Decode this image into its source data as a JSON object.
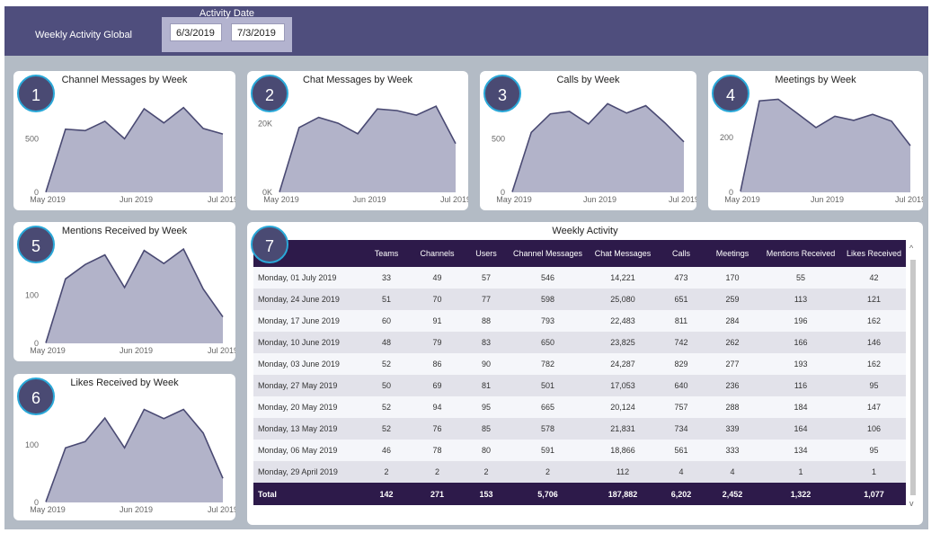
{
  "header": {
    "title": "Weekly Activity Global",
    "date_label": "Activity Date",
    "date_start": "6/3/2019",
    "date_end": "7/3/2019"
  },
  "colors": {
    "header_bg": "#4f4e7d",
    "area_fill": "#b2b3c9",
    "line": "#4a4a73",
    "table_header": "#2d1a4a",
    "badge_border": "#2aa8d8"
  },
  "charts": [
    {
      "badge": "1",
      "title": "Channel Messages by Week",
      "yticks": [
        "0",
        "500"
      ],
      "xticks": [
        "May 2019",
        "Jun 2019",
        "Jul 2019"
      ]
    },
    {
      "badge": "2",
      "title": "Chat Messages by Week",
      "yticks": [
        "0K",
        "20K"
      ],
      "xticks": [
        "May 2019",
        "Jun 2019",
        "Jul 2019"
      ]
    },
    {
      "badge": "3",
      "title": "Calls by Week",
      "yticks": [
        "0",
        "500"
      ],
      "xticks": [
        "May 2019",
        "Jun 2019",
        "Jul 2019"
      ]
    },
    {
      "badge": "4",
      "title": "Meetings by Week",
      "yticks": [
        "0",
        "200"
      ],
      "xticks": [
        "May 2019",
        "Jun 2019",
        "Jul 2019"
      ]
    },
    {
      "badge": "5",
      "title": "Mentions Received by Week",
      "yticks": [
        "0",
        "100"
      ],
      "xticks": [
        "May 2019",
        "Jun 2019",
        "Jul 2019"
      ]
    },
    {
      "badge": "6",
      "title": "Likes Received by Week",
      "yticks": [
        "0",
        "100"
      ],
      "xticks": [
        "May 2019",
        "Jun 2019",
        "Jul 2019"
      ]
    }
  ],
  "chart_data": [
    {
      "type": "area",
      "title": "Channel Messages by Week",
      "x": [
        "29 Apr",
        "06 May",
        "13 May",
        "20 May",
        "27 May",
        "03 Jun",
        "10 Jun",
        "17 Jun",
        "24 Jun",
        "01 Jul"
      ],
      "values": [
        2,
        591,
        578,
        665,
        501,
        782,
        650,
        793,
        598,
        546
      ],
      "ylim": [
        0,
        900
      ]
    },
    {
      "type": "area",
      "title": "Chat Messages by Week",
      "x": [
        "29 Apr",
        "06 May",
        "13 May",
        "20 May",
        "27 May",
        "03 Jun",
        "10 Jun",
        "17 Jun",
        "24 Jun",
        "01 Jul"
      ],
      "values": [
        112,
        18866,
        21831,
        20124,
        17053,
        24287,
        23825,
        22483,
        25080,
        14221
      ],
      "ylim": [
        0,
        28000
      ]
    },
    {
      "type": "area",
      "title": "Calls by Week",
      "x": [
        "29 Apr",
        "06 May",
        "13 May",
        "20 May",
        "27 May",
        "03 Jun",
        "10 Jun",
        "17 Jun",
        "24 Jun",
        "01 Jul"
      ],
      "values": [
        4,
        561,
        734,
        757,
        640,
        829,
        742,
        811,
        651,
        473
      ],
      "ylim": [
        0,
        900
      ]
    },
    {
      "type": "area",
      "title": "Meetings by Week",
      "x": [
        "29 Apr",
        "06 May",
        "13 May",
        "20 May",
        "27 May",
        "03 Jun",
        "10 Jun",
        "17 Jun",
        "24 Jun",
        "01 Jul"
      ],
      "values": [
        4,
        333,
        339,
        288,
        236,
        277,
        262,
        284,
        259,
        170
      ],
      "ylim": [
        0,
        350
      ]
    },
    {
      "type": "area",
      "title": "Mentions Received by Week",
      "x": [
        "29 Apr",
        "06 May",
        "13 May",
        "20 May",
        "27 May",
        "03 Jun",
        "10 Jun",
        "17 Jun",
        "24 Jun",
        "01 Jul"
      ],
      "values": [
        1,
        134,
        164,
        184,
        116,
        193,
        166,
        196,
        113,
        55
      ],
      "ylim": [
        0,
        200
      ]
    },
    {
      "type": "area",
      "title": "Likes Received by Week",
      "x": [
        "29 Apr",
        "06 May",
        "13 May",
        "20 May",
        "27 May",
        "03 Jun",
        "10 Jun",
        "17 Jun",
        "24 Jun",
        "01 Jul"
      ],
      "values": [
        1,
        95,
        106,
        147,
        95,
        162,
        146,
        162,
        121,
        42
      ],
      "ylim": [
        0,
        180
      ]
    }
  ],
  "table": {
    "badge": "7",
    "title": "Weekly Activity",
    "columns": [
      "",
      "Teams",
      "Channels",
      "Users",
      "Channel Messages",
      "Chat Messages",
      "Calls",
      "Meetings",
      "Mentions Received",
      "Likes Received"
    ],
    "rows": [
      [
        "Monday, 01 July 2019",
        "33",
        "49",
        "57",
        "546",
        "14,221",
        "473",
        "170",
        "55",
        "42"
      ],
      [
        "Monday, 24 June 2019",
        "51",
        "70",
        "77",
        "598",
        "25,080",
        "651",
        "259",
        "113",
        "121"
      ],
      [
        "Monday, 17 June 2019",
        "60",
        "91",
        "88",
        "793",
        "22,483",
        "811",
        "284",
        "196",
        "162"
      ],
      [
        "Monday, 10 June 2019",
        "48",
        "79",
        "83",
        "650",
        "23,825",
        "742",
        "262",
        "166",
        "146"
      ],
      [
        "Monday, 03 June 2019",
        "52",
        "86",
        "90",
        "782",
        "24,287",
        "829",
        "277",
        "193",
        "162"
      ],
      [
        "Monday, 27 May 2019",
        "50",
        "69",
        "81",
        "501",
        "17,053",
        "640",
        "236",
        "116",
        "95"
      ],
      [
        "Monday, 20 May 2019",
        "52",
        "94",
        "95",
        "665",
        "20,124",
        "757",
        "288",
        "184",
        "147"
      ],
      [
        "Monday, 13 May 2019",
        "52",
        "76",
        "85",
        "578",
        "21,831",
        "734",
        "339",
        "164",
        "106"
      ],
      [
        "Monday, 06 May 2019",
        "46",
        "78",
        "80",
        "591",
        "18,866",
        "561",
        "333",
        "134",
        "95"
      ],
      [
        "Monday, 29 April 2019",
        "2",
        "2",
        "2",
        "2",
        "112",
        "4",
        "4",
        "1",
        "1"
      ]
    ],
    "total": [
      "Total",
      "142",
      "271",
      "153",
      "5,706",
      "187,882",
      "6,202",
      "2,452",
      "1,322",
      "1,077"
    ],
    "scroll_up": "^",
    "scroll_down": "v"
  }
}
